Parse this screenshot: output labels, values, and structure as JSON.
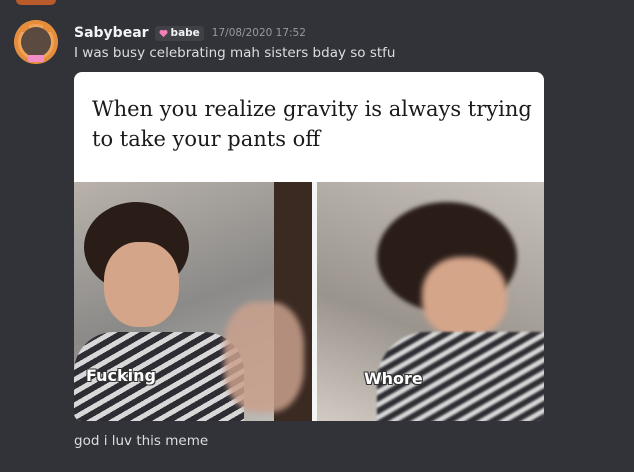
{
  "message": {
    "username": "Sabybear",
    "role_tag": {
      "label": "babe",
      "icon": "heart-icon",
      "color": "#f47fb5"
    },
    "timestamp": "17/08/2020 17:52",
    "text": "I was busy celebrating mah sisters bday so stfu",
    "followup": "god i luv this meme"
  },
  "meme": {
    "caption": "When you realize gravity is always trying to take your pants off",
    "left_label": "Fucking",
    "right_label": "Whore"
  },
  "colors": {
    "background": "#313338",
    "username": "#f2f3f5",
    "timestamp": "#949ba4",
    "text": "#dbdee1"
  }
}
